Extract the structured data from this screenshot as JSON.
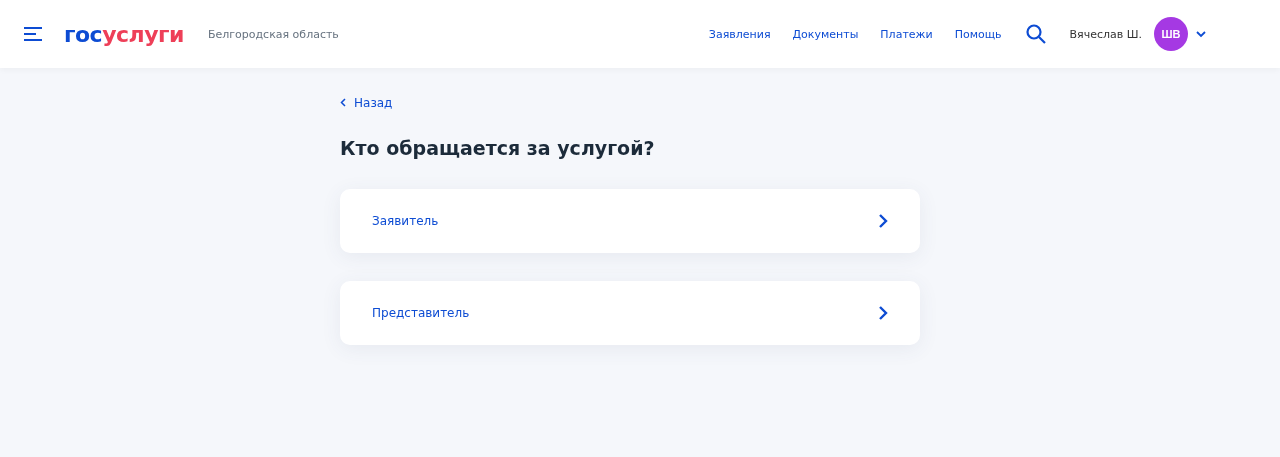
{
  "header": {
    "logo": {
      "first": "гос",
      "second": "услуги"
    },
    "region": "Белгородская область",
    "nav": [
      "Заявления",
      "Документы",
      "Платежи",
      "Помощь"
    ],
    "user": {
      "name": "Вячеслав Ш.",
      "initials": "ШВ"
    }
  },
  "back": "Назад",
  "title": "Кто обращается за услугой?",
  "options": [
    {
      "label": "Заявитель"
    },
    {
      "label": "Представитель"
    }
  ]
}
